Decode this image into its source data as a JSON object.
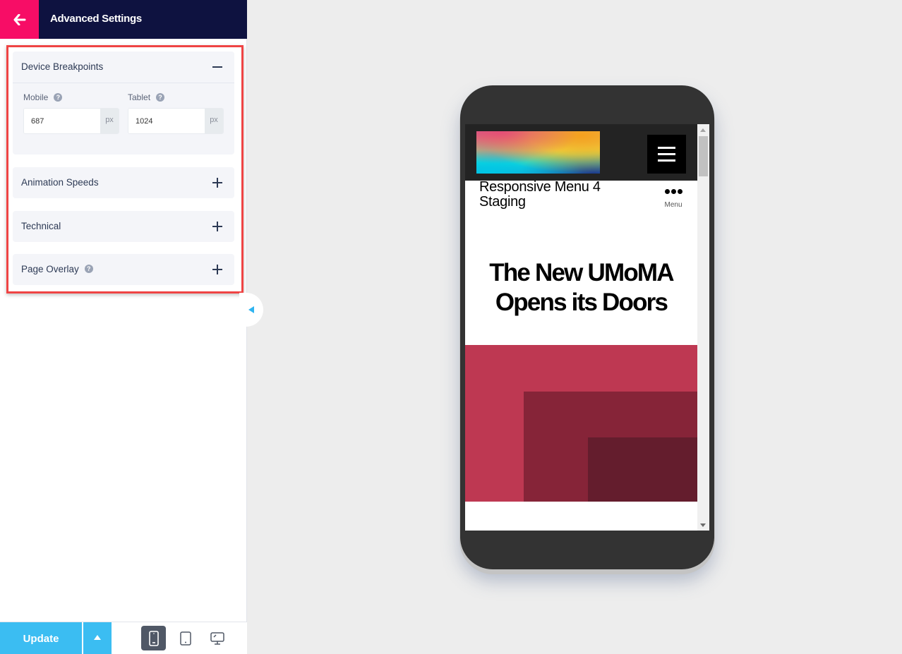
{
  "topbar": {
    "back_icon": "arrow-left-icon",
    "title": "Advanced Settings"
  },
  "panels": {
    "device_breakpoints": {
      "title": "Device Breakpoints",
      "state": "expanded",
      "toggle_icon": "minus-icon",
      "fields": {
        "mobile": {
          "label": "Mobile",
          "value": "687",
          "unit": "px",
          "help_icon": "help-icon"
        },
        "tablet": {
          "label": "Tablet",
          "value": "1024",
          "unit": "px",
          "help_icon": "help-icon"
        }
      }
    },
    "animation_speeds": {
      "title": "Animation Speeds",
      "state": "collapsed",
      "toggle_icon": "plus-icon"
    },
    "technical": {
      "title": "Technical",
      "state": "collapsed",
      "toggle_icon": "plus-icon"
    },
    "page_overlay": {
      "title": "Page Overlay",
      "state": "collapsed",
      "toggle_icon": "plus-icon",
      "help_icon": "help-icon"
    }
  },
  "footer": {
    "update_label": "Update",
    "update_menu_icon": "caret-up-icon",
    "devices": [
      {
        "name": "mobile",
        "icon": "mobile-icon",
        "active": true
      },
      {
        "name": "tablet",
        "icon": "tablet-icon",
        "active": false
      },
      {
        "name": "desktop",
        "icon": "desktop-icon",
        "active": false
      }
    ]
  },
  "preview": {
    "site_title": "Responsive Menu 4 Staging",
    "menu_label": "Menu",
    "headline": "The New UMoMA Opens its Doors",
    "hamburger_icon": "hamburger-icon",
    "more_icon": "more-dots-icon"
  },
  "colors": {
    "accent_pink": "#f70d66",
    "header_navy": "#0e1240",
    "update_blue": "#3bbdf2",
    "highlight_red": "#ef4444",
    "hero_red": "#be3852",
    "hero_dark": "#862438",
    "hero_darkest": "#641d2d"
  }
}
